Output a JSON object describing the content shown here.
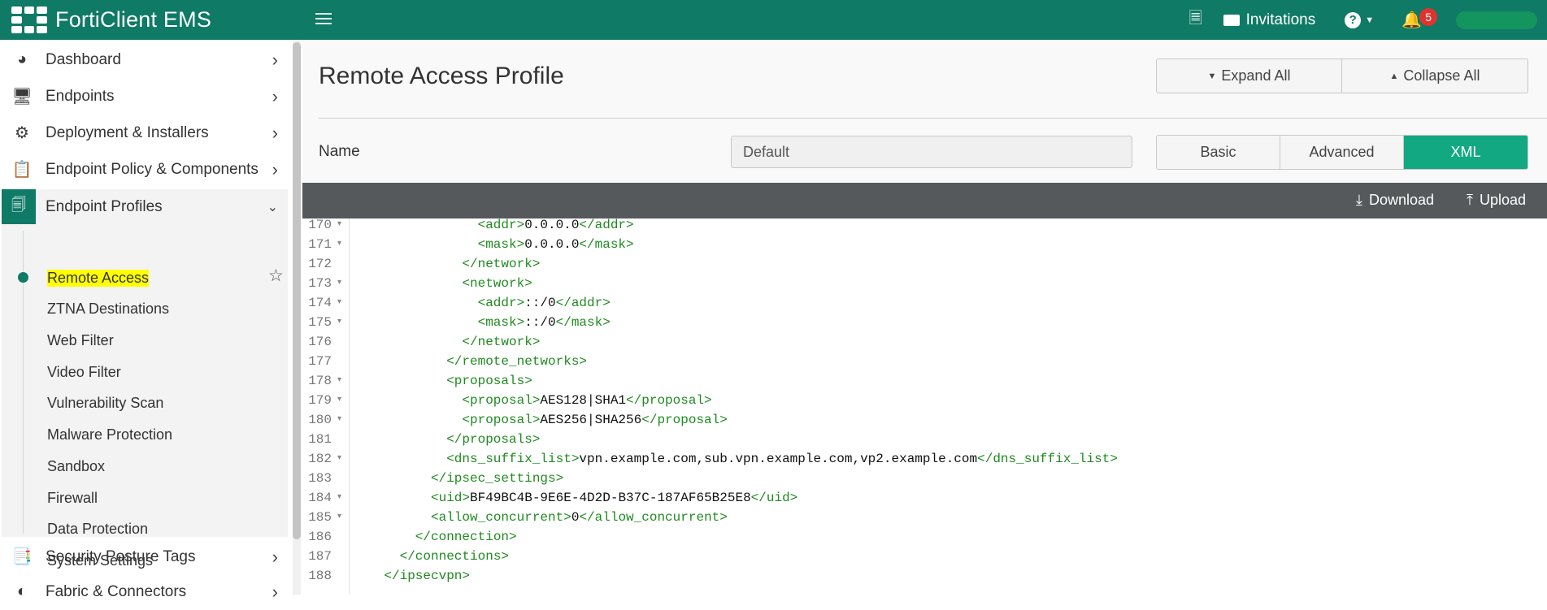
{
  "app": {
    "title": "FortiClient EMS"
  },
  "topbar": {
    "invitations_label": "Invitations",
    "notification_count": "5"
  },
  "sidebar": {
    "items": [
      {
        "label": "Dashboard"
      },
      {
        "label": "Endpoints"
      },
      {
        "label": "Deployment & Installers"
      },
      {
        "label": "Endpoint Policy & Components"
      },
      {
        "label": "Endpoint Profiles"
      },
      {
        "label": "Security Posture Tags"
      },
      {
        "label": "Fabric & Connectors"
      }
    ],
    "subitems": [
      {
        "label": "Remote Access",
        "active": true
      },
      {
        "label": "ZTNA Destinations"
      },
      {
        "label": "Web Filter"
      },
      {
        "label": "Video Filter"
      },
      {
        "label": "Vulnerability Scan"
      },
      {
        "label": "Malware Protection"
      },
      {
        "label": "Sandbox"
      },
      {
        "label": "Firewall"
      },
      {
        "label": "Data Protection"
      },
      {
        "label": "System Settings"
      }
    ]
  },
  "main": {
    "title": "Remote Access Profile",
    "expand_all": "Expand All",
    "collapse_all": "Collapse All",
    "name_label": "Name",
    "name_value": "Default",
    "tabs": [
      {
        "label": "Basic"
      },
      {
        "label": "Advanced"
      },
      {
        "label": "XML",
        "active": true
      }
    ],
    "download_label": "Download",
    "upload_label": "Upload"
  },
  "editor": {
    "lines": [
      {
        "n": "170",
        "fold": true,
        "indent": 8,
        "parts": [
          [
            "t",
            "<addr>"
          ],
          [
            "x",
            "0.0.0.0"
          ],
          [
            "t",
            "</addr>"
          ]
        ]
      },
      {
        "n": "171",
        "fold": true,
        "indent": 8,
        "parts": [
          [
            "t",
            "<mask>"
          ],
          [
            "x",
            "0.0.0.0"
          ],
          [
            "t",
            "</mask>"
          ]
        ]
      },
      {
        "n": "172",
        "fold": false,
        "indent": 7,
        "parts": [
          [
            "t",
            "</network>"
          ]
        ]
      },
      {
        "n": "173",
        "fold": true,
        "indent": 7,
        "parts": [
          [
            "t",
            "<network>"
          ]
        ]
      },
      {
        "n": "174",
        "fold": true,
        "indent": 8,
        "parts": [
          [
            "t",
            "<addr>"
          ],
          [
            "x",
            "::/0"
          ],
          [
            "t",
            "</addr>"
          ]
        ]
      },
      {
        "n": "175",
        "fold": true,
        "indent": 8,
        "parts": [
          [
            "t",
            "<mask>"
          ],
          [
            "x",
            "::/0"
          ],
          [
            "t",
            "</mask>"
          ]
        ]
      },
      {
        "n": "176",
        "fold": false,
        "indent": 7,
        "parts": [
          [
            "t",
            "</network>"
          ]
        ]
      },
      {
        "n": "177",
        "fold": false,
        "indent": 6,
        "parts": [
          [
            "t",
            "</remote_networks>"
          ]
        ]
      },
      {
        "n": "178",
        "fold": true,
        "indent": 6,
        "parts": [
          [
            "t",
            "<proposals>"
          ]
        ]
      },
      {
        "n": "179",
        "fold": true,
        "indent": 7,
        "parts": [
          [
            "t",
            "<proposal>"
          ],
          [
            "x",
            "AES128|SHA1"
          ],
          [
            "t",
            "</proposal>"
          ]
        ]
      },
      {
        "n": "180",
        "fold": true,
        "indent": 7,
        "parts": [
          [
            "t",
            "<proposal>"
          ],
          [
            "x",
            "AES256|SHA256"
          ],
          [
            "t",
            "</proposal>"
          ]
        ]
      },
      {
        "n": "181",
        "fold": false,
        "indent": 6,
        "parts": [
          [
            "t",
            "</proposals>"
          ]
        ]
      },
      {
        "n": "182",
        "fold": true,
        "indent": 6,
        "parts": [
          [
            "t",
            "<dns_suffix_list>"
          ],
          [
            "x",
            "vpn.example.com,sub.vpn.example.com,vp2.example.com"
          ],
          [
            "t",
            "</dns_suffix_list>"
          ]
        ]
      },
      {
        "n": "183",
        "fold": false,
        "indent": 5,
        "parts": [
          [
            "t",
            "</ipsec_settings>"
          ]
        ]
      },
      {
        "n": "184",
        "fold": true,
        "indent": 5,
        "parts": [
          [
            "t",
            "<uid>"
          ],
          [
            "x",
            "BF49BC4B-9E6E-4D2D-B37C-187AF65B25E8"
          ],
          [
            "t",
            "</uid>"
          ]
        ]
      },
      {
        "n": "185",
        "fold": true,
        "indent": 5,
        "parts": [
          [
            "t",
            "<allow_concurrent>"
          ],
          [
            "x",
            "0"
          ],
          [
            "t",
            "</allow_concurrent>"
          ]
        ]
      },
      {
        "n": "186",
        "fold": false,
        "indent": 4,
        "parts": [
          [
            "t",
            "</connection>"
          ]
        ]
      },
      {
        "n": "187",
        "fold": false,
        "indent": 3,
        "parts": [
          [
            "t",
            "</connections>"
          ]
        ]
      },
      {
        "n": "188",
        "fold": false,
        "indent": 2,
        "parts": [
          [
            "t",
            "</ipsecvpn>"
          ]
        ]
      }
    ]
  },
  "colors": {
    "brand": "#0f7a66",
    "active_tab": "#12a882",
    "xml_tag": "#1f8a1f",
    "highlight": "#ffff00"
  }
}
